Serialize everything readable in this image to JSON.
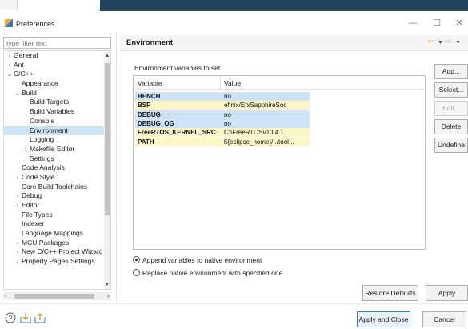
{
  "window": {
    "title": "Preferences",
    "minimize": "—",
    "maximize": "☐",
    "close": "✕"
  },
  "filter": {
    "placeholder": "type filter text"
  },
  "tree": [
    {
      "label": "General",
      "arrow": "›",
      "indent": 0
    },
    {
      "label": "Ant",
      "arrow": "›",
      "indent": 0
    },
    {
      "label": "C/C++",
      "arrow": "⌄",
      "indent": 0
    },
    {
      "label": "Appearance",
      "arrow": "",
      "indent": 1
    },
    {
      "label": "Build",
      "arrow": "⌄",
      "indent": 1
    },
    {
      "label": "Build Targets",
      "arrow": "",
      "indent": 2
    },
    {
      "label": "Build Variables",
      "arrow": "",
      "indent": 2
    },
    {
      "label": "Console",
      "arrow": "",
      "indent": 2
    },
    {
      "label": "Environment",
      "arrow": "",
      "indent": 2,
      "selected": true
    },
    {
      "label": "Logging",
      "arrow": "",
      "indent": 2
    },
    {
      "label": "Makefile Editor",
      "arrow": "›",
      "indent": 2
    },
    {
      "label": "Settings",
      "arrow": "",
      "indent": 2
    },
    {
      "label": "Code Analysis",
      "arrow": "",
      "indent": 1
    },
    {
      "label": "Code Style",
      "arrow": "›",
      "indent": 1
    },
    {
      "label": "Core Build Toolchains",
      "arrow": "",
      "indent": 1
    },
    {
      "label": "Debug",
      "arrow": "›",
      "indent": 1
    },
    {
      "label": "Editor",
      "arrow": "›",
      "indent": 1
    },
    {
      "label": "File Types",
      "arrow": "",
      "indent": 1
    },
    {
      "label": "Indexer",
      "arrow": "",
      "indent": 1
    },
    {
      "label": "Language Mappings",
      "arrow": "",
      "indent": 1
    },
    {
      "label": "MCU Packages",
      "arrow": "›",
      "indent": 1
    },
    {
      "label": "New C/C++ Project Wizard",
      "arrow": "›",
      "indent": 1
    },
    {
      "label": "Property Pages Settings",
      "arrow": "›",
      "indent": 1
    }
  ],
  "page": {
    "title": "Environment"
  },
  "env": {
    "section_label": "Environment variables to set",
    "headers": {
      "variable": "Variable",
      "value": "Value"
    },
    "rows": [
      {
        "name": "BENCH",
        "value": "no",
        "color": "#cfe3f6"
      },
      {
        "name": "BSP",
        "value": "efinix/EfxSapphireSoc",
        "color": "#fbf5c8"
      },
      {
        "name": "DEBUG",
        "value": "no",
        "color": "#cfe3f6"
      },
      {
        "name": "DEBUG_OG",
        "value": "no",
        "color": "#cfe3f6"
      },
      {
        "name": "FreeRTOS_KERNEL_SRC",
        "value": "C:\\FreeRTOSv10.4.1",
        "color": "#fbf5c8"
      },
      {
        "name": "PATH",
        "value": "${eclipse_home}/../tool...",
        "color": "#fbf5c8"
      }
    ]
  },
  "side_buttons": {
    "add": "Add...",
    "select": "Select...",
    "edit": "Edit...",
    "delete": "Delete",
    "undefine": "Undefine"
  },
  "radios": {
    "append": "Append variables to native environment",
    "replace": "Replace native environment with specified one",
    "selected": "append"
  },
  "buttons": {
    "restore": "Restore Defaults",
    "apply": "Apply",
    "apply_close": "Apply and Close",
    "cancel": "Cancel"
  },
  "colors": {
    "accent": "#3c7fc8",
    "selection": "#cde4f7",
    "system_var": "#cfe3f6",
    "user_var": "#fbf5c8"
  },
  "icons": [
    "help-icon",
    "import-icon",
    "export-icon"
  ]
}
